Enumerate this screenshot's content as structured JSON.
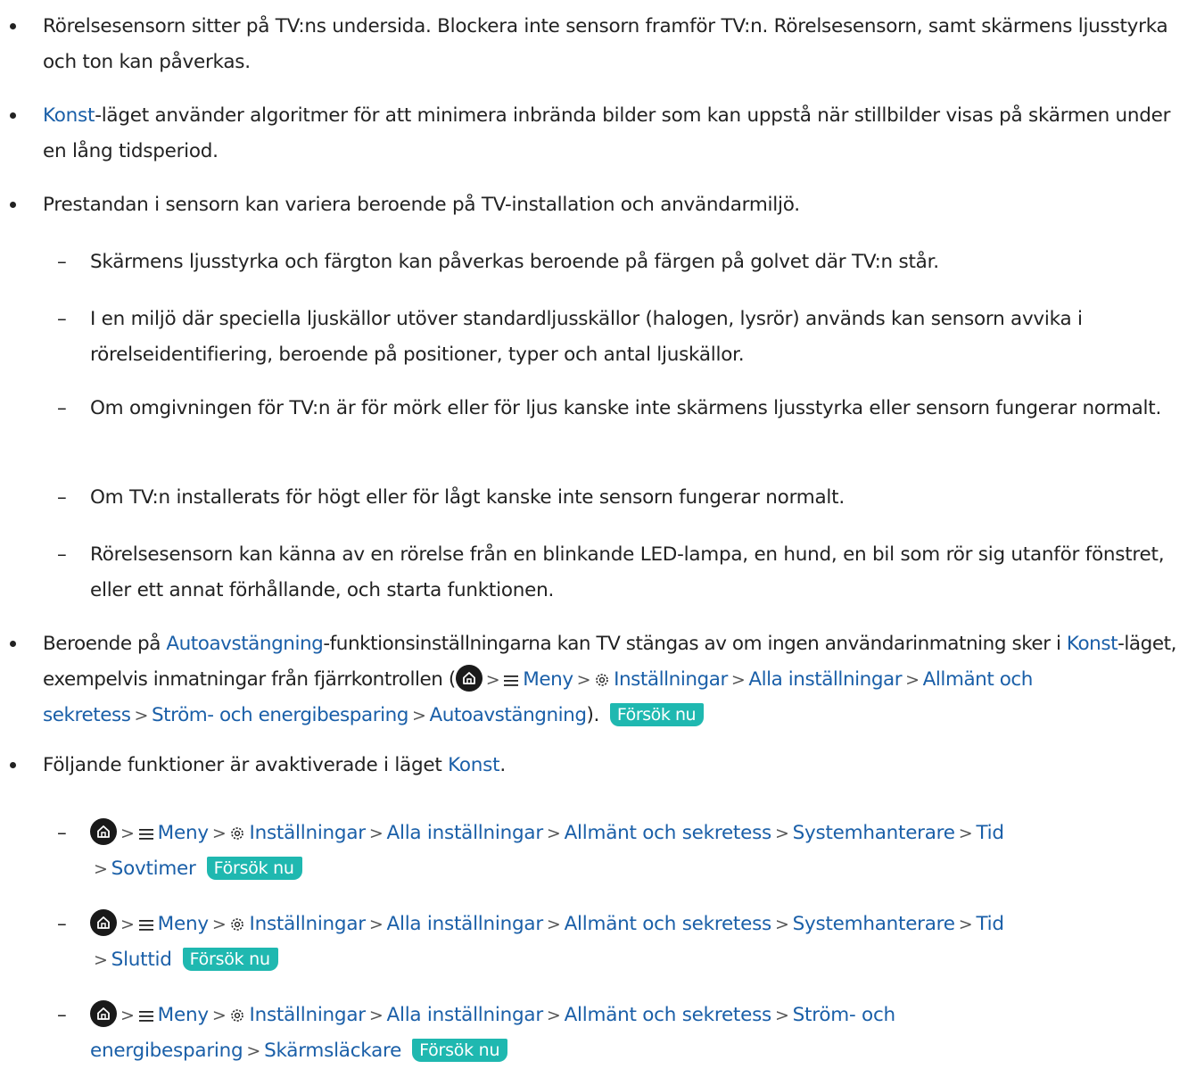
{
  "menu_path": {
    "meny": "Meny",
    "installningar": "Inställningar",
    "alla_installningar": "Alla inställningar",
    "allmant": "Allmänt och sekretess",
    "systemhanterare": "Systemhanterare",
    "tid": "Tid",
    "strom_a": "Ström- och",
    "strom_b": "energibesparing",
    "strom_full": "Ström- och energibesparing",
    "sovtimer": "Sovtimer",
    "sluttid": "Sluttid",
    "skarmslackare": "Skärmsläckare",
    "autoavstangning": "Autoavstängning"
  },
  "try_now": "Försök nu",
  "icons": [
    "home-icon",
    "menu-icon",
    "gear-icon",
    "chevron-right-icon"
  ],
  "colors": {
    "link": "#1a5fa8",
    "try_now_bg": "#1fb8b0",
    "text": "#222222"
  },
  "items": {
    "b1": "Rörelsesensorn sitter på TV:ns undersida. Blockera inte sensorn framför TV:n. Rörelsesensorn, samt skärmens ljusstyrka och ton kan påverkas.",
    "b2_link": "Konst",
    "b2_text": "-läget använder algoritmer för att minimera inbrända bilder som kan uppstå när stillbilder visas på skärmen under en lång tidsperiod.",
    "b3": "Prestandan i sensorn kan variera beroende på TV-installation och användarmiljö.",
    "s1": "Skärmens ljusstyrka och färgton kan påverkas beroende på färgen på golvet där TV:n står.",
    "s2": "I en miljö där speciella ljuskällor utöver standardljusskällor (halogen, lysrör) används kan sensorn avvika i rörelseidentifiering, beroende på positioner, typer och antal ljuskällor.",
    "s3": "Om omgivningen för TV:n är för mörk eller för ljus kanske inte skärmens ljusstyrka eller sensorn fungerar normalt.",
    "s4": "Om TV:n installerats för högt eller för lågt kanske inte sensorn fungerar normalt.",
    "s5": "Rörelsesensorn kan känna av en rörelse från en blinkande LED-lampa, en hund, en bil som rör sig utanför fönstret, eller ett annat förhållande, och starta funktionen.",
    "b4_text1": "Beroende på ",
    "b4_link1": "Autoavstängning",
    "b4_text2": "-funktionsinställningarna kan TV stängas av om ingen användarinmatning sker i ",
    "b4_link2": "Konst",
    "b4_text3": "-läget, exempelvis inmatningar från fjärrkontrollen (",
    "b4_text4": ").",
    "b5_text": "Följande funktioner är avaktiverade i läget ",
    "b5_link": "Konst",
    "b5_end": ".",
    "dash": "–",
    "sep": ">"
  }
}
